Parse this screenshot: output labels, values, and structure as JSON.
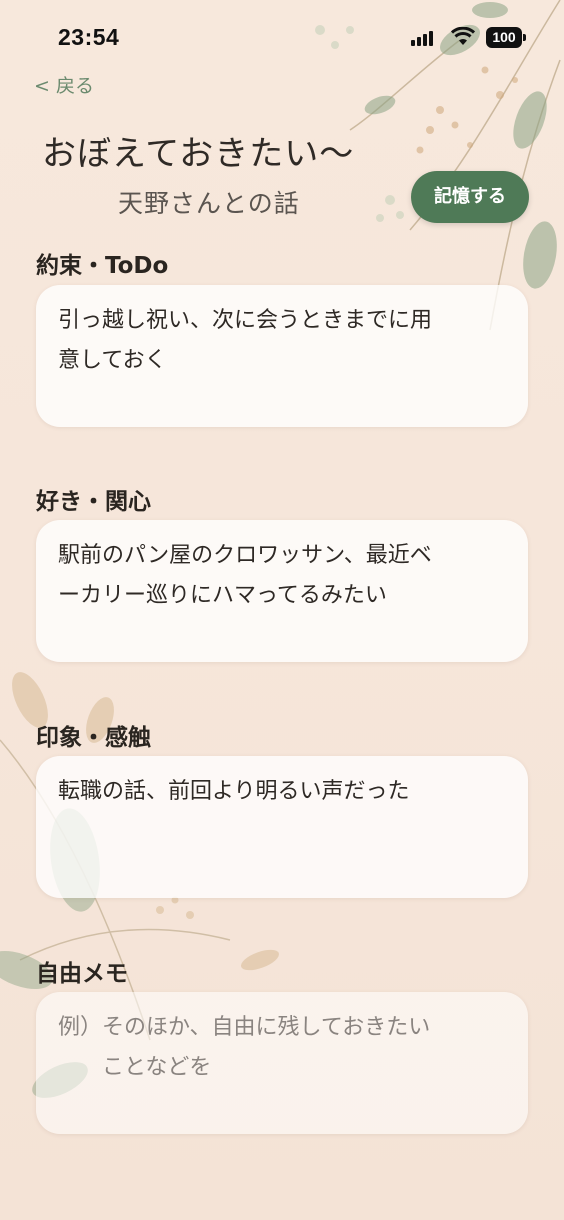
{
  "status_bar": {
    "time": "23:54",
    "battery": "100"
  },
  "nav": {
    "back_label": "< 戻る"
  },
  "header": {
    "title": "おぼえておきたい〜",
    "subtitle": "天野さんとの話",
    "save_button": "記憶する"
  },
  "sections": [
    {
      "label": "約束・ToDo",
      "text": "引っ越し祝い、次に会うときまでに用\n意しておく"
    },
    {
      "label": "好き・関心",
      "text": "駅前のパン屋のクロワッサン、最近ベ\nーカリー巡りにハマってるみたい"
    },
    {
      "label": "印象・感触",
      "text": "転職の話、前回より明るい声だった"
    },
    {
      "label": "自由メモ",
      "placeholder": "例）そのほか、自由に残しておきたい\n　　ことなどを"
    }
  ],
  "colors": {
    "accent": "#4f7a57",
    "background": "#f7e8dc",
    "back_link": "#6b8a6e"
  },
  "icons": [
    "signal-icon",
    "wifi-icon",
    "battery-icon",
    "leaf-decoration"
  ]
}
